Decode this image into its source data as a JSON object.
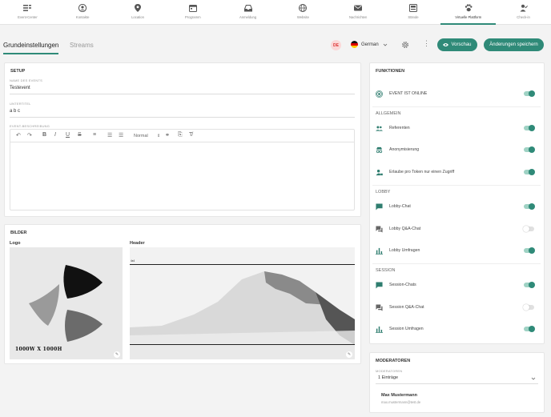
{
  "nav": [
    {
      "label": "Event-Center",
      "icon": "list-icon"
    },
    {
      "label": "Kontakte",
      "icon": "user-circle-icon"
    },
    {
      "label": "Location",
      "icon": "map-pin-icon"
    },
    {
      "label": "Programm",
      "icon": "calendar-icon"
    },
    {
      "label": "Anmeldung",
      "icon": "inbox-icon"
    },
    {
      "label": "Website",
      "icon": "globe-icon"
    },
    {
      "label": "Nachrichten",
      "icon": "mail-icon"
    },
    {
      "label": "Stände",
      "icon": "booth-icon"
    },
    {
      "label": "Virtuelle Plattform",
      "icon": "paw-icon"
    },
    {
      "label": "Check-in",
      "icon": "person-check-icon"
    }
  ],
  "active_nav": "Virtuelle Plattform",
  "tabs": {
    "basic": "Grundeinstellungen",
    "streams": "Streams"
  },
  "toolbar": {
    "flag_badge": "DE",
    "language": "German",
    "preview": "Vorschau",
    "save": "Änderungen speichern",
    "accent": "#2f8a78"
  },
  "setup": {
    "title": "SETUP",
    "name_label": "NAME DES EVENTS",
    "name_value": "Testevent",
    "subtitle_label": "UNTERTITEL",
    "subtitle_value": "a b c",
    "desc_label": "EVENT-BESCHREIBUNG",
    "format": "Normal"
  },
  "images": {
    "title": "BILDER",
    "logo_label": "Logo",
    "header_label": "Header",
    "logo_size": "1000W X 1000H",
    "header_tag": "4x4"
  },
  "functions": {
    "title": "FUNKTIONEN",
    "online": {
      "label": "EVENT IST ONLINE",
      "on": true
    },
    "general": {
      "title": "ALLGEMEIN",
      "items": [
        {
          "label": "Referenten",
          "on": true
        },
        {
          "label": "Anonymisierung",
          "on": true
        },
        {
          "label": "Erlaube pro Token nur einen Zugriff",
          "on": true
        }
      ]
    },
    "lobby": {
      "title": "LOBBY",
      "items": [
        {
          "label": "Lobby-Chat",
          "on": true
        },
        {
          "label": "Lobby Q&A-Chat",
          "on": false
        },
        {
          "label": "Lobby Umfragen",
          "on": true
        }
      ]
    },
    "session": {
      "title": "SESSION",
      "items": [
        {
          "label": "Session-Chats",
          "on": true
        },
        {
          "label": "Session Q&A-Chat",
          "on": false
        },
        {
          "label": "Session Umfragen",
          "on": true
        }
      ]
    }
  },
  "moderators": {
    "title": "MODERATOREN",
    "label": "MODERATOREN",
    "select_value": "1 Einträge",
    "person_name": "Max Mustermann",
    "person_email": "max.mustermann@test.de"
  }
}
